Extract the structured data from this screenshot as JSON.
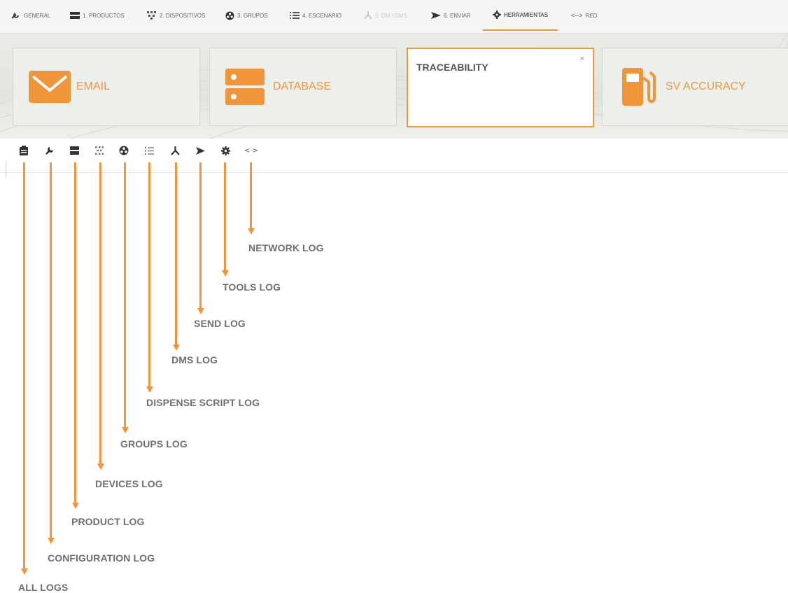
{
  "nav": {
    "general": "GENERAL",
    "productos": "1. PRODUCTOS",
    "dispositivos": "2. DISPOSITIVOS",
    "grupos": "3. GRUPOS",
    "escenario": "4. ESCENARIO",
    "dms": "5. DM / DMS",
    "enviar": "6. ENVIAR",
    "herramientas": "HERRAMIENTAS",
    "red": "RED"
  },
  "tiles": {
    "email": "EMAIL",
    "database": "DATABASE",
    "traceability": "TRACEABILITY",
    "close": "×",
    "sv_accuracy": "SV ACCURACY"
  },
  "annotations": {
    "network": "NETWORK LOG",
    "tools": "TOOLS LOG",
    "send": "SEND LOG",
    "dms": "DMS LOG",
    "dispense": "DISPENSE SCRIPT LOG",
    "groups": "GROUPS LOG",
    "devices": "DEVICES LOG",
    "product": "PRODUCT LOG",
    "configuration": "CONFIGURATION LOG",
    "all": "ALL LOGS"
  },
  "colors": {
    "accent": "#f0953a",
    "annotation_text": "#6f6f6f",
    "icon": "#333333"
  },
  "icons": [
    "clipboard-icon",
    "wrench-icon",
    "server-icon",
    "devices-icon",
    "groups-icon",
    "list-icon",
    "fork-icon",
    "send-icon",
    "gear-icon",
    "network-icon"
  ]
}
